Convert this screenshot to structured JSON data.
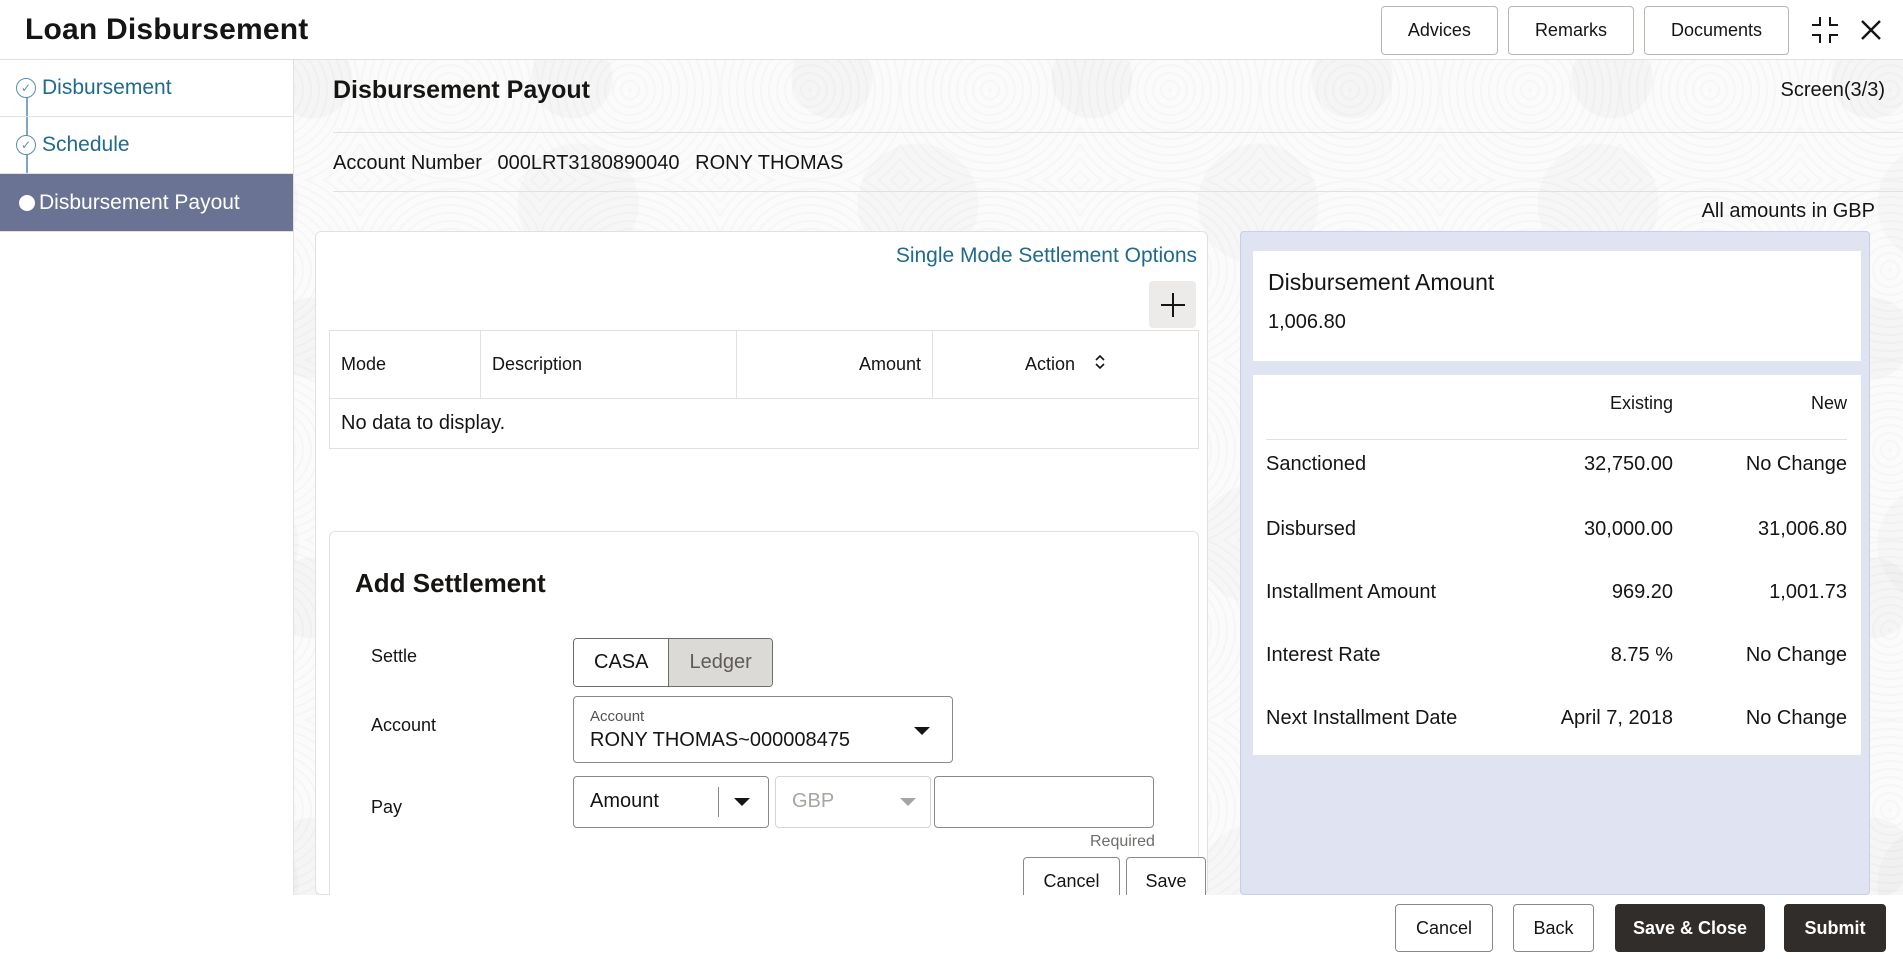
{
  "header": {
    "title": "Loan Disbursement",
    "buttons": [
      "Advices",
      "Remarks",
      "Documents"
    ]
  },
  "sidebar": {
    "steps": [
      {
        "label": "Disbursement",
        "state": "completed"
      },
      {
        "label": "Schedule",
        "state": "completed"
      },
      {
        "label": "Disbursement Payout",
        "state": "active"
      }
    ]
  },
  "main": {
    "title": "Disbursement Payout",
    "screen": "Screen(3/3)",
    "account_label": "Account Number",
    "account_number": "000LRT3180890040",
    "account_name": "RONY THOMAS",
    "amounts_note": "All amounts in GBP",
    "settlement_link": "Single Mode Settlement Options",
    "table": {
      "columns": [
        "Mode",
        "Description",
        "Amount",
        "Action"
      ],
      "empty": "No data to display."
    },
    "add_settlement": {
      "title": "Add Settlement",
      "settle_label": "Settle",
      "settle_options": [
        "CASA",
        "Ledger"
      ],
      "settle_selected": "CASA",
      "account_label": "Account",
      "account_field_label": "Account",
      "account_value": "RONY THOMAS~000008475",
      "pay_label": "Pay",
      "pay_value": "Amount",
      "currency_value": "GBP",
      "amount_value": "",
      "required_text": "Required",
      "cancel": "Cancel",
      "save": "Save"
    }
  },
  "summary": {
    "disbursement_amount_label": "Disbursement Amount",
    "disbursement_amount": "1,006.80",
    "col_existing": "Existing",
    "col_new": "New",
    "rows": [
      {
        "label": "Sanctioned",
        "existing": "32,750.00",
        "new": "No Change"
      },
      {
        "label": "Disbursed",
        "existing": "30,000.00",
        "new": "31,006.80"
      },
      {
        "label": "Installment Amount",
        "existing": "969.20",
        "new": "1,001.73"
      },
      {
        "label": "Interest Rate",
        "existing": "8.75 %",
        "new": "No Change"
      },
      {
        "label": "Next Installment Date",
        "existing": "April 7, 2018",
        "new": "No Change"
      }
    ]
  },
  "footer": {
    "cancel": "Cancel",
    "back": "Back",
    "save_close": "Save & Close",
    "submit": "Submit"
  },
  "colors": {
    "accent_link": "#1f6a8d",
    "sidebar_active": "#6a7393",
    "summary_bg": "#dfe3f2",
    "primary_button": "#312d2a"
  }
}
